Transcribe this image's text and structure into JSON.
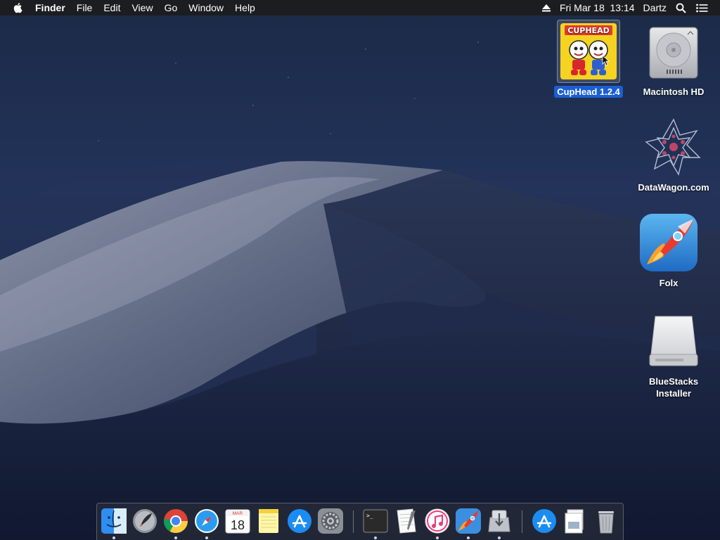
{
  "menubar": {
    "apple_icon": "apple-logo-icon",
    "app_name": "Finder",
    "menus": [
      "File",
      "Edit",
      "View",
      "Go",
      "Window",
      "Help"
    ],
    "status": {
      "eject_icon": "eject-icon",
      "datetime": "Fri Mar 18  13:14",
      "user": "Dartz",
      "search_icon": "spotlight-search-icon",
      "list_icon": "notification-center-icon"
    }
  },
  "desktop": {
    "icons": [
      {
        "label": "CupHead 1.2.4",
        "icon": "cuphead-app-icon",
        "selected": true,
        "image_text": "CUPHEAD"
      },
      {
        "label": "Macintosh HD",
        "icon": "hard-drive-icon",
        "selected": false
      },
      {
        "label": "DataWagon.com",
        "icon": "datawagon-logo-icon",
        "selected": false
      },
      {
        "label": "Folx",
        "icon": "folx-rocket-icon",
        "selected": false
      },
      {
        "label": "BlueStacks\nInstaller",
        "label_line1": "BlueStacks",
        "label_line2": "Installer",
        "icon": "external-drive-icon",
        "selected": false
      }
    ]
  },
  "dock": {
    "items": [
      {
        "name": "finder",
        "icon": "finder-icon",
        "running": true
      },
      {
        "name": "launchpad",
        "icon": "launchpad-icon",
        "running": false
      },
      {
        "name": "chrome",
        "icon": "chrome-icon",
        "running": true
      },
      {
        "name": "safari",
        "icon": "safari-icon",
        "running": true
      },
      {
        "name": "calendar",
        "icon": "calendar-icon",
        "running": false,
        "month": "MAR",
        "day": "18"
      },
      {
        "name": "notes",
        "icon": "notes-icon",
        "running": false
      },
      {
        "name": "app-store",
        "icon": "app-store-icon",
        "running": false
      },
      {
        "name": "system-preferences",
        "icon": "system-preferences-icon",
        "running": false
      },
      {
        "name": "terminal",
        "icon": "terminal-icon",
        "running": true
      },
      {
        "name": "textedit",
        "icon": "textedit-icon",
        "running": false
      },
      {
        "name": "itunes",
        "icon": "itunes-icon",
        "running": true
      },
      {
        "name": "folx",
        "icon": "folx-icon",
        "running": true
      },
      {
        "name": "installer",
        "icon": "installer-icon",
        "running": true
      },
      {
        "name": "applications-folder",
        "icon": "applications-stack-icon",
        "running": false
      },
      {
        "name": "documents",
        "icon": "documents-stack-icon",
        "running": false
      },
      {
        "name": "trash",
        "icon": "trash-icon",
        "running": false
      }
    ]
  },
  "colors": {
    "selection_blue": "#1b5fd0",
    "menubar_bg": "#1c1c1e"
  }
}
